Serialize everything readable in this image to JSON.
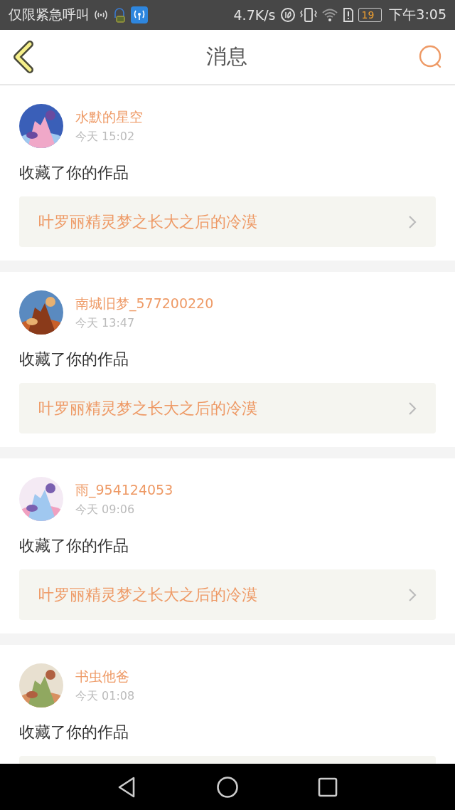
{
  "status_bar": {
    "carrier": "仅限紧急呼叫",
    "speed": "4.7K/s",
    "battery": "19",
    "time": "下午3:05"
  },
  "header": {
    "title": "消息"
  },
  "messages": [
    {
      "user": "水默的星空",
      "time": "今天 15:02",
      "action": "收藏了你的作品",
      "link": "叶罗丽精灵梦之长大之后的冷漠"
    },
    {
      "user": "南城旧梦_577200220",
      "time": "今天 13:47",
      "action": "收藏了你的作品",
      "link": "叶罗丽精灵梦之长大之后的冷漠"
    },
    {
      "user": "雨_954124053",
      "time": "今天 09:06",
      "action": "收藏了你的作品",
      "link": "叶罗丽精灵梦之长大之后的冷漠"
    },
    {
      "user": "书虫他爸",
      "time": "今天 01:08",
      "action": "收藏了你的作品"
    }
  ]
}
